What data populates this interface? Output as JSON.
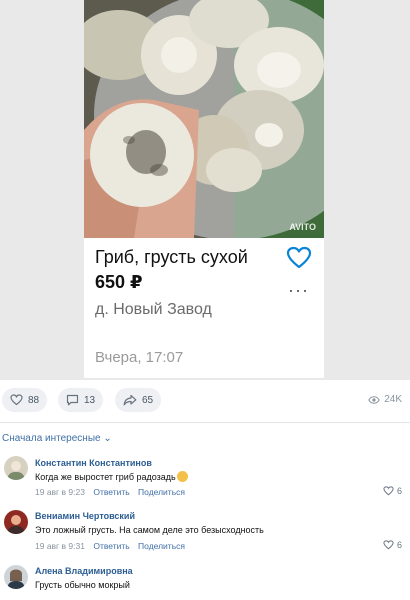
{
  "listing": {
    "title": "Гриб, грусть сухой",
    "price": "650 ₽",
    "location": "д. Новый Завод",
    "date": "Вчера, 17:07",
    "watermark": "AVITO"
  },
  "icons": {
    "favorite": "heart-outline-icon",
    "more": "more-dots-icon",
    "like": "heart-icon",
    "comment": "comment-icon",
    "share": "share-icon",
    "views": "eye-icon"
  },
  "colors": {
    "accent_blue": "#2c5d93",
    "link_blue": "#3f6fa6",
    "favorite_heart": "#0a84d6"
  },
  "post_actions": {
    "likes": "88",
    "comments": "13",
    "shares": "65",
    "views": "24K"
  },
  "comments_sort": {
    "label": "Сначала интересные",
    "chevron": "⌄"
  },
  "comments": [
    {
      "author": "Константин Константинов",
      "text": "Когда же выростет гриб радозадь",
      "time": "19 авг в 9:23",
      "reply": "Ответить",
      "share": "Поделиться",
      "likes": "6"
    },
    {
      "author": "Вениамин Чертовский",
      "text": "Это ложный грусть. На самом деле это безысходность",
      "time": "19 авг в 9:31",
      "reply": "Ответить",
      "share": "Поделиться",
      "likes": "6"
    },
    {
      "author": "Алена Владимировна",
      "text": "Грусть обычно мокрый"
    }
  ]
}
